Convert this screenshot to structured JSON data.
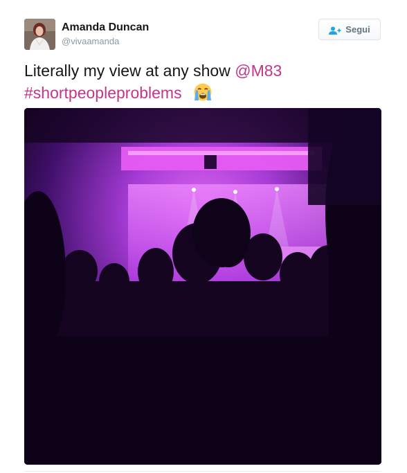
{
  "user": {
    "name": "Amanda Duncan",
    "handle": "@vivaamanda"
  },
  "follow_button": {
    "label": "Segui",
    "icon": "follow-user-icon"
  },
  "tweet": {
    "text_prefix": "Literally my view at any show ",
    "mention": "@M83",
    "hashtag": "#shortpeopleproblems",
    "emoji": "loudly-crying-face-icon"
  },
  "colors": {
    "link": "#c0368e",
    "follow_icon": "#1da1f2",
    "stage_light": "#e94df5"
  }
}
